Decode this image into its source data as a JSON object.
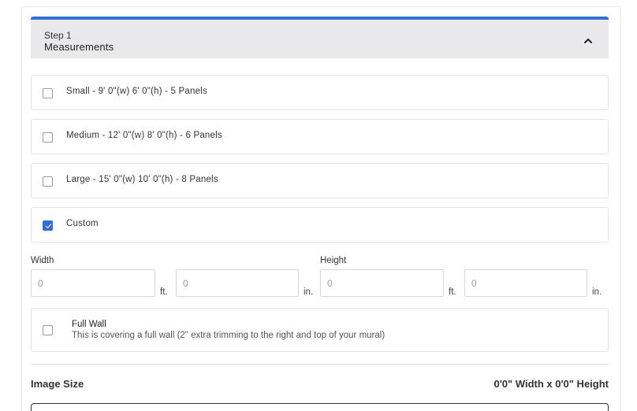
{
  "step": {
    "label": "Step 1",
    "title": "Measurements"
  },
  "options": [
    {
      "label": "Small - 9' 0\"(w) 6' 0\"(h) - 5 Panels",
      "checked": false
    },
    {
      "label": "Medium - 12' 0\"(w) 8' 0\"(h) - 6 Panels",
      "checked": false
    },
    {
      "label": "Large - 15' 0\"(w) 10' 0\"(h) - 8 Panels",
      "checked": false
    },
    {
      "label": "Custom",
      "checked": true
    }
  ],
  "custom": {
    "width_label": "Width",
    "height_label": "Height",
    "width_ft_placeholder": "0",
    "width_in_placeholder": "0",
    "height_ft_placeholder": "0",
    "height_in_placeholder": "0",
    "unit_ft": "ft.",
    "unit_in": "in."
  },
  "full_wall": {
    "title": "Full Wall",
    "description": "This is covering a full wall (2\" extra trimming to the right and top of your mural)",
    "checked": false
  },
  "image_size": {
    "label": "Image Size",
    "value": "0'0\" Width x 0'0\" Height"
  },
  "colors": {
    "accent": "#2f6fd6",
    "header_bg": "#e9e9ec"
  },
  "icons": {
    "collapse": "chevron-up-icon",
    "check": "checkmark-icon"
  }
}
